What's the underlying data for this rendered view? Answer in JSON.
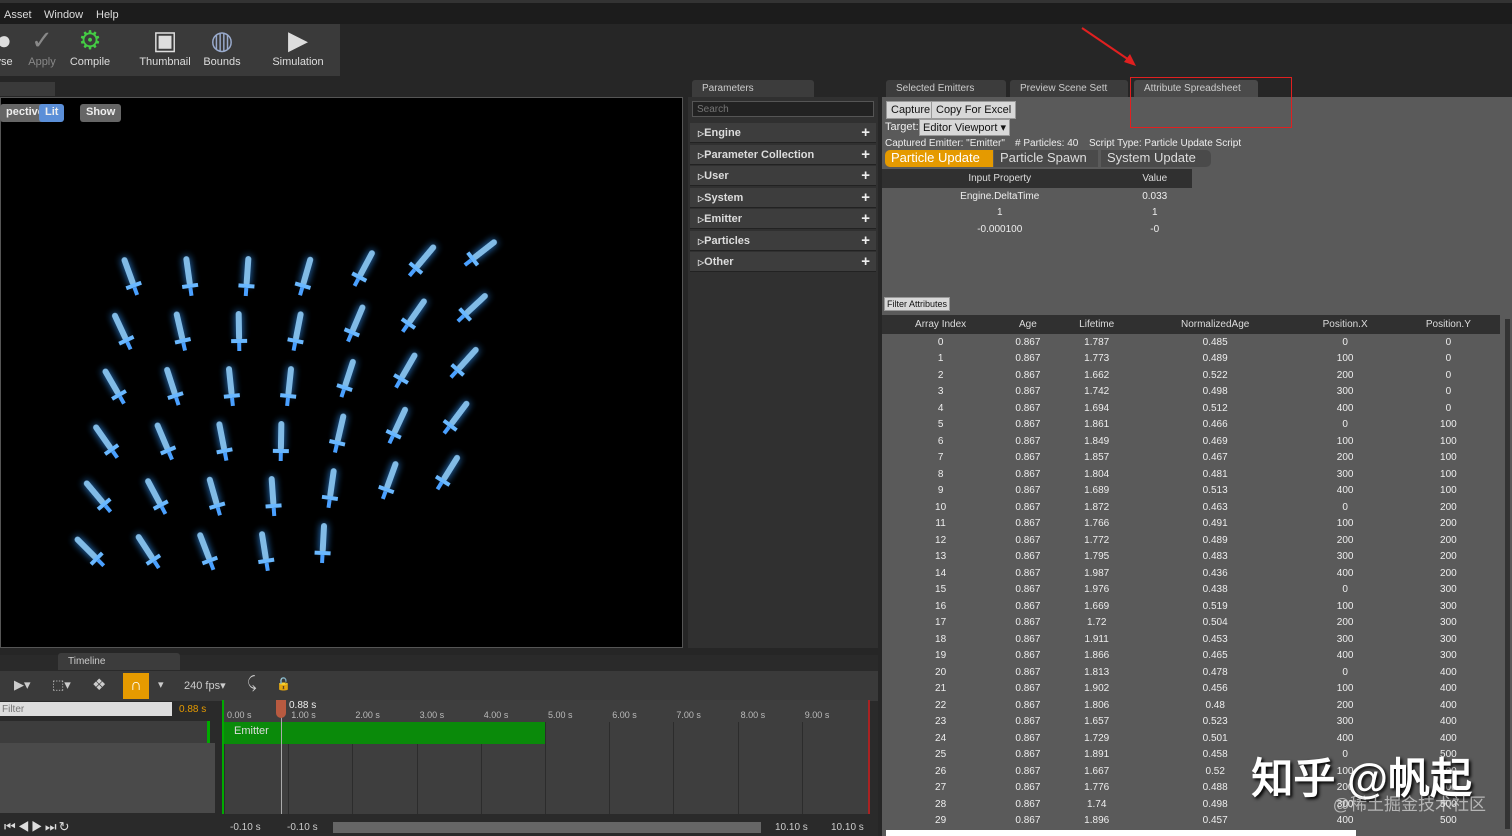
{
  "menu": [
    "Asset",
    "Window",
    "Help"
  ],
  "toolbar": [
    {
      "label": "vse",
      "icon": "browse-icon"
    },
    {
      "label": "Apply",
      "icon": "apply-icon"
    },
    {
      "label": "Compile",
      "icon": "compile-icon"
    },
    {
      "label": "Thumbnail",
      "icon": "thumbnail-icon"
    },
    {
      "label": "Bounds",
      "icon": "bounds-icon"
    },
    {
      "label": "Simulation",
      "icon": "play-icon"
    }
  ],
  "viewport": {
    "buttons": [
      "pective",
      "Lit",
      "Show"
    ]
  },
  "params": {
    "tab": "Parameters",
    "search_placeholder": "Search",
    "sections": [
      "Engine",
      "Parameter Collection",
      "User",
      "System",
      "Emitter",
      "Particles",
      "Other"
    ]
  },
  "tabs": [
    "Selected Emitters",
    "Preview Scene Sett",
    "Attribute Spreadsheet"
  ],
  "spreadsheet": {
    "capture": "Capture",
    "copy": "Copy For Excel",
    "target_label": "Target:",
    "target_value": "Editor Viewport",
    "captured_emitter": "Captured Emitter: \"Emitter\"",
    "particles": "# Particles: 40",
    "script_type": "Script Type: Particle Update Script",
    "script_tabs": [
      "Particle Update",
      "Particle Spawn",
      "System Update"
    ],
    "input_headers": [
      "Input Property",
      "Value"
    ],
    "inputs": [
      [
        "Engine.DeltaTime",
        "0.033"
      ],
      [
        "1",
        "1"
      ],
      [
        "-0.000100",
        "-0"
      ]
    ],
    "filter": "Filter Attributes",
    "headers": [
      "Array Index",
      "Age",
      "Lifetime",
      "NormalizedAge",
      "Position.X",
      "Position.Y"
    ],
    "rows": [
      [
        "0",
        "0.867",
        "1.787",
        "0.485",
        "0",
        "0"
      ],
      [
        "1",
        "0.867",
        "1.773",
        "0.489",
        "100",
        "0"
      ],
      [
        "2",
        "0.867",
        "1.662",
        "0.522",
        "200",
        "0"
      ],
      [
        "3",
        "0.867",
        "1.742",
        "0.498",
        "300",
        "0"
      ],
      [
        "4",
        "0.867",
        "1.694",
        "0.512",
        "400",
        "0"
      ],
      [
        "5",
        "0.867",
        "1.861",
        "0.466",
        "0",
        "100"
      ],
      [
        "6",
        "0.867",
        "1.849",
        "0.469",
        "100",
        "100"
      ],
      [
        "7",
        "0.867",
        "1.857",
        "0.467",
        "200",
        "100"
      ],
      [
        "8",
        "0.867",
        "1.804",
        "0.481",
        "300",
        "100"
      ],
      [
        "9",
        "0.867",
        "1.689",
        "0.513",
        "400",
        "100"
      ],
      [
        "10",
        "0.867",
        "1.872",
        "0.463",
        "0",
        "200"
      ],
      [
        "11",
        "0.867",
        "1.766",
        "0.491",
        "100",
        "200"
      ],
      [
        "12",
        "0.867",
        "1.772",
        "0.489",
        "200",
        "200"
      ],
      [
        "13",
        "0.867",
        "1.795",
        "0.483",
        "300",
        "200"
      ],
      [
        "14",
        "0.867",
        "1.987",
        "0.436",
        "400",
        "200"
      ],
      [
        "15",
        "0.867",
        "1.976",
        "0.438",
        "0",
        "300"
      ],
      [
        "16",
        "0.867",
        "1.669",
        "0.519",
        "100",
        "300"
      ],
      [
        "17",
        "0.867",
        "1.72",
        "0.504",
        "200",
        "300"
      ],
      [
        "18",
        "0.867",
        "1.911",
        "0.453",
        "300",
        "300"
      ],
      [
        "19",
        "0.867",
        "1.866",
        "0.465",
        "400",
        "300"
      ],
      [
        "20",
        "0.867",
        "1.813",
        "0.478",
        "0",
        "400"
      ],
      [
        "21",
        "0.867",
        "1.902",
        "0.456",
        "100",
        "400"
      ],
      [
        "22",
        "0.867",
        "1.806",
        "0.48",
        "200",
        "400"
      ],
      [
        "23",
        "0.867",
        "1.657",
        "0.523",
        "300",
        "400"
      ],
      [
        "24",
        "0.867",
        "1.729",
        "0.501",
        "400",
        "400"
      ],
      [
        "25",
        "0.867",
        "1.891",
        "0.458",
        "0",
        "500"
      ],
      [
        "26",
        "0.867",
        "1.667",
        "0.52",
        "100",
        "500"
      ],
      [
        "27",
        "0.867",
        "1.776",
        "0.488",
        "200",
        "500"
      ],
      [
        "28",
        "0.867",
        "1.74",
        "0.498",
        "300",
        "500"
      ],
      [
        "29",
        "0.867",
        "1.896",
        "0.457",
        "400",
        "500"
      ]
    ]
  },
  "timeline": {
    "tab": "Timeline",
    "fps": "240 fps",
    "filter_placeholder": "Filter",
    "current_time": "0.88 s",
    "playhead": "0.88 s",
    "ticks": [
      "0.00 s",
      "1.00 s",
      "2.00 s",
      "3.00 s",
      "4.00 s",
      "5.00 s",
      "6.00 s",
      "7.00 s",
      "8.00 s",
      "9.00 s"
    ],
    "track": "Emitter",
    "range": [
      "-0.10 s",
      "-0.10 s",
      "10.10 s",
      "10.10 s"
    ]
  },
  "watermark": "知乎 @帆起",
  "watermark2": "@稀土掘金技术社区",
  "colors": {
    "accent": "#e59a00",
    "track": "#0a8a0a",
    "highlight": "#e02020"
  }
}
